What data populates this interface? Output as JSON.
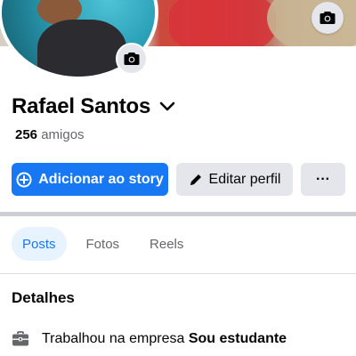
{
  "profile": {
    "name": "Rafael Santos",
    "friends_count": "256",
    "friends_label": "amigos"
  },
  "actions": {
    "add_story": "Adicionar ao story",
    "edit_profile": "Editar perfil",
    "more": "···"
  },
  "tabs": [
    {
      "label": "Posts",
      "active": true
    },
    {
      "label": "Fotos",
      "active": false
    },
    {
      "label": "Reels",
      "active": false
    }
  ],
  "details": {
    "title": "Detalhes",
    "work_prefix": "Trabalhou na empresa",
    "work_value": "Sou estudante"
  },
  "icons": {
    "cover_camera": "camera-icon",
    "avatar_camera": "camera-icon",
    "name_dropdown": "chevron-down-icon",
    "add_story": "plus-circle-icon",
    "edit": "pencil-icon",
    "work": "briefcase-icon"
  },
  "colors": {
    "accent": "#1877f2",
    "secondary_bg": "#e4e6eb",
    "muted_text": "#65676b",
    "active_tab_bg": "#e7f3ff"
  }
}
